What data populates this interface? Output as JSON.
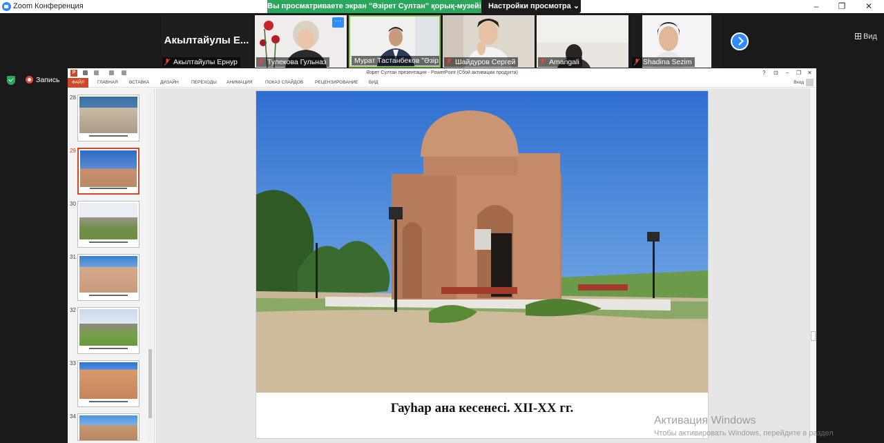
{
  "window": {
    "title": "Zoom Конференция"
  },
  "share_banner": {
    "message": "Вы просматриваете экран \"Әзірет Султан\" қорық-музейі",
    "view_options": "Настройки просмотра ⌄"
  },
  "participants": [
    {
      "name": "Акылтайулы Ернур",
      "display": "Акылтайулы  Е...",
      "muted": true,
      "video": false
    },
    {
      "name": "Тулекова Гульназ",
      "muted": true,
      "video": true
    },
    {
      "name": "Мурат Тастанбеков \"Әзір...",
      "muted": false,
      "video": true,
      "active_speaker": true
    },
    {
      "name": "Шайдуров Сергей",
      "muted": true,
      "video": true
    },
    {
      "name": "Amangali",
      "muted": true,
      "video": true
    },
    {
      "name": "Shadina Sezim",
      "muted": true,
      "video": true
    }
  ],
  "toolbar": {
    "view_label": "Вид",
    "recording_label": "Запись"
  },
  "powerpoint": {
    "doc_title": "Әзрет Султан презентация - PowerPoint (Сбой активации продукта)",
    "ribbon_tabs": [
      "ФАЙЛ",
      "ГЛАВНАЯ",
      "ВСТАВКА",
      "ДИЗАЙН",
      "ПЕРЕХОДЫ",
      "АНИМАЦИЯ",
      "ПОКАЗ СЛАЙДОВ",
      "РЕЦЕНЗИРОВАНИЕ",
      "ВИД"
    ],
    "sign_in": "Вход",
    "help_icons": [
      "?",
      "⊡",
      "–",
      "❐",
      "✕"
    ],
    "thumbnails": [
      {
        "number": "28",
        "active": false
      },
      {
        "number": "29",
        "active": true
      },
      {
        "number": "30",
        "active": false
      },
      {
        "number": "31",
        "active": false
      },
      {
        "number": "32",
        "active": false
      },
      {
        "number": "33",
        "active": false
      },
      {
        "number": "34",
        "active": false
      }
    ],
    "current_slide": {
      "caption": "Гауhар ана кесенесі. XII-XX гг."
    }
  },
  "activation": {
    "title": "Активация Windows",
    "hint": "Чтобы активировать Windows, перейдите в раздел"
  },
  "colors": {
    "zoom_blue": "#2d8cff",
    "share_green": "#2aa75a",
    "ppt_red": "#d24726"
  }
}
